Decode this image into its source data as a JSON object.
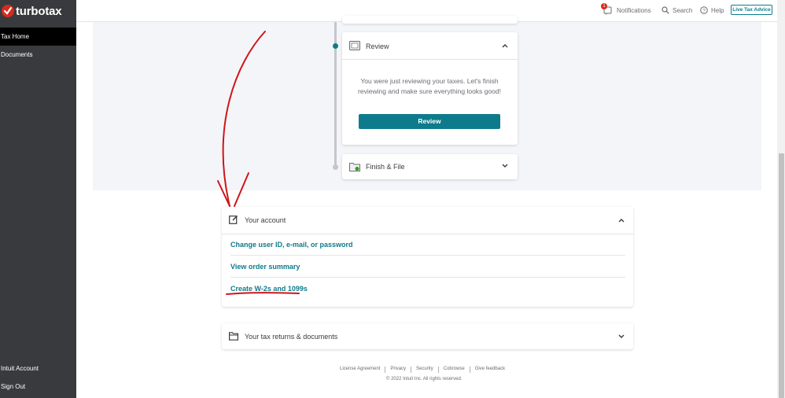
{
  "brand": {
    "name": "turbotax"
  },
  "sidebar": {
    "items": [
      {
        "label": "Tax Home",
        "active": true
      },
      {
        "label": "Documents",
        "active": false
      }
    ],
    "bottom_items": [
      {
        "label": "Intuit Account"
      },
      {
        "label": "Sign Out"
      }
    ]
  },
  "header": {
    "notifications_label": "Notifications",
    "notifications_count": "1",
    "search_label": "Search",
    "help_label": "Help",
    "live_advice_label": "Live Tax Advice"
  },
  "steps": {
    "review": {
      "title": "Review",
      "description": "You were just reviewing your taxes. Let's finish reviewing and make sure everything looks good!",
      "button_label": "Review",
      "expanded": true
    },
    "finish": {
      "title": "Finish & File",
      "expanded": false
    }
  },
  "account": {
    "title": "Your account",
    "links": [
      "Change user ID, e-mail, or password",
      "View order summary",
      "Create W-2s and 1099s"
    ]
  },
  "tax_returns": {
    "title": "Your tax returns & documents"
  },
  "footer": {
    "links": [
      "License Agreement",
      "Privacy",
      "Security",
      "Cobrowse",
      "Give feedback"
    ],
    "copyright": "© 2022 Intuit Inc. All rights reserved."
  },
  "colors": {
    "accent": "#0d7b8b",
    "sidebar_bg": "#393a3d",
    "brand_red": "#d52b1e",
    "annotation_red": "#d0151a"
  },
  "icons": [
    "bell-icon",
    "search-icon",
    "help-icon",
    "chevron-up-icon",
    "chevron-down-icon",
    "edit-icon",
    "folder-icon"
  ]
}
